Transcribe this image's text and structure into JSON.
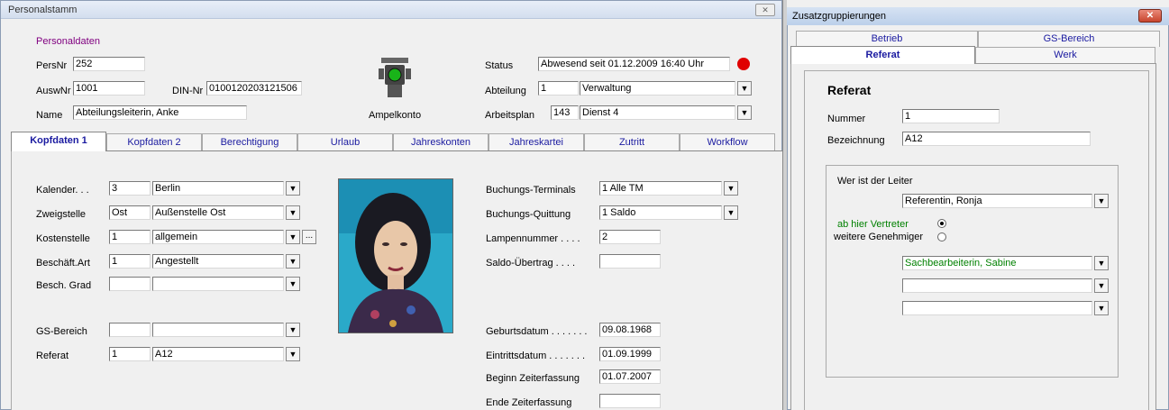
{
  "window": {
    "title": "Personalstamm",
    "close": "✕"
  },
  "section_title": "Personaldaten",
  "header": {
    "persnr_label": "PersNr",
    "persnr": "252",
    "auswnr_label": "AuswNr",
    "auswnr": "1001",
    "din_label": "DIN-Nr",
    "din": "0100120203121506",
    "name_label": "Name",
    "name": "Abteilungsleiterin, Anke",
    "ampel_label": "Ampelkonto",
    "status_label": "Status",
    "status": "Abwesend seit   01.12.2009  16:40  Uhr",
    "abteilung_label": "Abteilung",
    "abteilung_nr": "1",
    "abteilung": "Verwaltung",
    "arbeitsplan_label": "Arbeitsplan",
    "arbeitsplan_nr": "143",
    "arbeitsplan": "Dienst 4"
  },
  "tabs": [
    "Kopfdaten 1",
    "Kopfdaten 2",
    "Berechtigung",
    "Urlaub",
    "Jahreskonten",
    "Jahreskartei",
    "Zutritt",
    "Workflow"
  ],
  "kopf": {
    "kalender_label": "Kalender. . .",
    "kalender_nr": "3",
    "kalender": "Berlin",
    "zweig_label": "Zweigstelle",
    "zweig_nr": "Ost",
    "zweig": "Außenstelle Ost",
    "kosten_label": "Kostenstelle",
    "kosten_nr": "1",
    "kosten": "allgemein",
    "beschart_label": "Beschäft.Art",
    "beschart_nr": "1",
    "beschart": "Angestellt",
    "beschgrad_label": "Besch. Grad",
    "gs_label": "GS-Bereich",
    "referat_label": "Referat",
    "referat_nr": "1",
    "referat": "A12",
    "more_button": "..."
  },
  "right": {
    "terminals_label": "Buchungs-Terminals",
    "terminals": "1  Alle TM",
    "quittung_label": "Buchungs-Quittung",
    "quittung": "1  Saldo",
    "lampe_label": "Lampennummer . . . .",
    "lampe": "2",
    "saldo_label": "Saldo-Übertrag . . . .",
    "saldo": "",
    "geburt_label": "Geburtsdatum . . . . . . .",
    "geburt": "09.08.1968",
    "eintritt_label": "Eintrittsdatum . . . . . . .",
    "eintritt": "01.09.1999",
    "beginn_label": "Beginn Zeiterfassung",
    "beginn": "01.07.2007",
    "ende_label": "Ende  Zeiterfassung",
    "ende": ""
  },
  "panel2": {
    "title": "Zusatzgruppierungen",
    "tabs_back": [
      "Betrieb",
      "GS-Bereich"
    ],
    "tabs_front": [
      "Referat",
      "Werk"
    ],
    "heading": "Referat",
    "nummer_label": "Nummer",
    "nummer": "1",
    "bez_label": "Bezeichnung",
    "bez": "A12",
    "leiter_label": "Wer ist der Leiter",
    "leiter": "Referentin, Ronja",
    "vertreter_label": "ab hier Vertreter",
    "genehmiger_label": "weitere Genehmiger",
    "vertreter1": "Sachbearbeiterin, Sabine",
    "vertreter2": "",
    "vertreter3": ""
  },
  "colors": {
    "purple_label": "#800080",
    "green_label": "#008000",
    "tab_text": "#1a1aa0",
    "status_dot": "#e00000"
  }
}
